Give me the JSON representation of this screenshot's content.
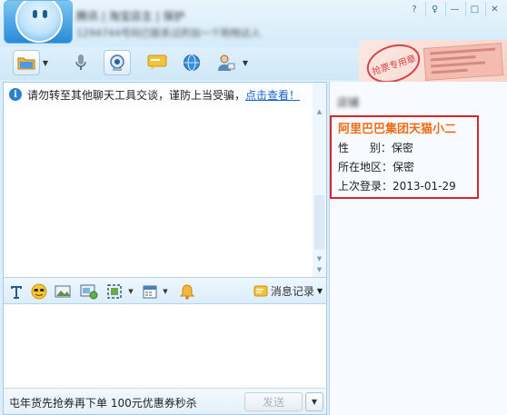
{
  "header": {
    "contact_name": "腾讯 | 淘宝店主 | 保护",
    "signature": "1294744号码已联系过的加一个购物达人",
    "window_controls": [
      "?",
      "♀",
      "—",
      "□",
      "✕"
    ]
  },
  "toolbar": {
    "buttons": [
      {
        "icon": "folder-icon",
        "has_dropdown": true
      },
      {
        "icon": "microphone-icon",
        "has_dropdown": false
      },
      {
        "icon": "webcam-icon",
        "has_dropdown": false
      },
      {
        "icon": "chat-bubble-icon",
        "has_dropdown": false
      },
      {
        "icon": "globe-icon",
        "has_dropdown": false
      },
      {
        "icon": "contact-icon",
        "has_dropdown": true
      }
    ]
  },
  "ad": {
    "stamp_text": "抢票专用章",
    "colors": {
      "stamp": "#d8414a",
      "ticket": "#f4bcb0"
    }
  },
  "notice": {
    "text": "请勿转至其他聊天工具交谈，谨防上当受骗，",
    "link": "点击查看！"
  },
  "format_toolbar": {
    "icons": [
      "font-icon",
      "emoji-icon",
      "image-icon",
      "screenshot-icon",
      "screen-capture-icon",
      "calendar-icon",
      "bell-icon"
    ],
    "history_label": "消息记录"
  },
  "bottom": {
    "promo_text": "屯年货先抢券再下单 100元优惠券秒杀",
    "send_label": "发送"
  },
  "side": {
    "title": "店铺",
    "profile": {
      "shop_name": "阿里巴巴集团天猫小二",
      "gender_label": "性      别：",
      "gender_value": "保密",
      "region_label": "所在地区：",
      "region_value": "保密",
      "last_login_label": "上次登录：",
      "last_login_value": "2013-01-29"
    }
  },
  "colors": {
    "accent": "#1a64c8",
    "shop_name": "#ef6c13",
    "highlight_border": "#d9262c"
  }
}
